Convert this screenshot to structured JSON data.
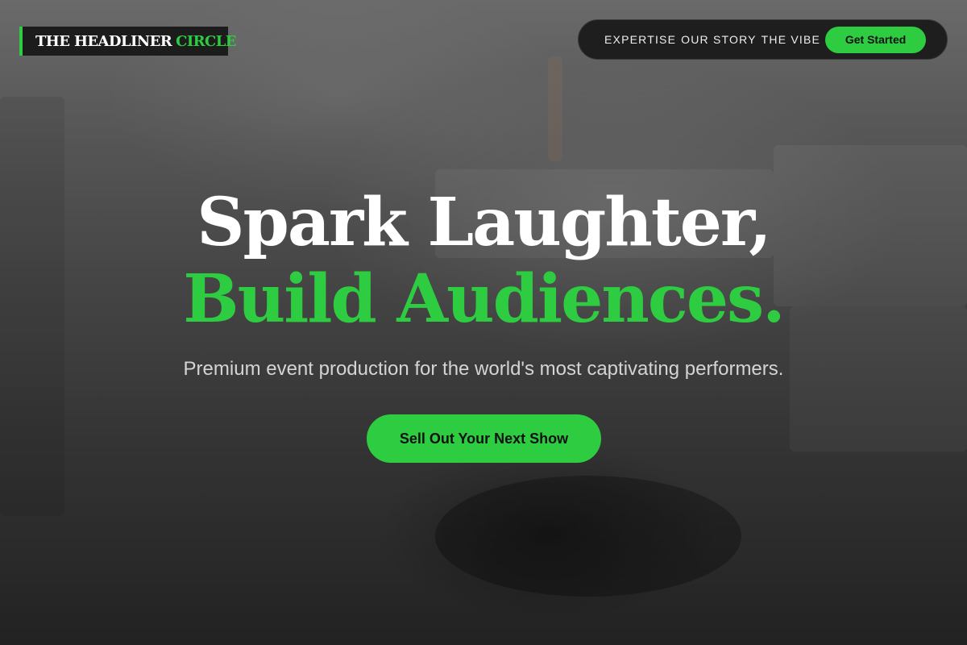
{
  "brand": {
    "name_part_1": "THE HEADLINER",
    "name_part_2": "CIRCLE",
    "accent_color": "#2ecc40",
    "logo_bg_color": "#1c1c1c"
  },
  "nav": {
    "links": [
      "EXPERTISE",
      "OUR STORY",
      "THE VIBE"
    ],
    "cta_label": "Get Started"
  },
  "hero": {
    "headline_line_1": "Spark Laughter,",
    "headline_line_2": "Build Audiences.",
    "subtitle": "Premium event production for the world's most captivating performers.",
    "cta_label": "Sell Out Your Next Show",
    "headline_color": "#ffffff",
    "headline_accent_color": "#2ecc40"
  }
}
